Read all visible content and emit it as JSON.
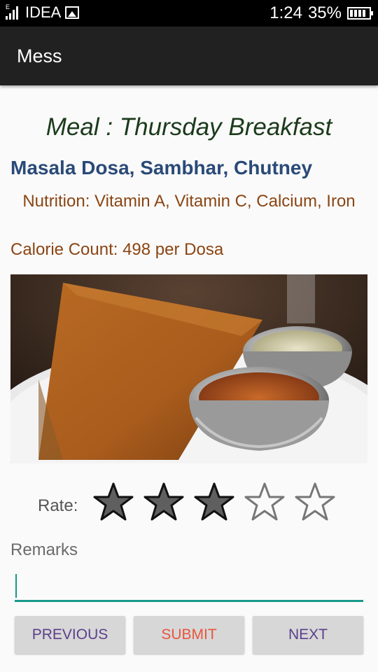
{
  "status_bar": {
    "network_type": "E",
    "carrier": "IDEA",
    "time": "1:24",
    "battery_percent": "35%",
    "icons": [
      "signal-icon",
      "gallery-icon",
      "battery-icon"
    ]
  },
  "app_bar": {
    "title": "Mess"
  },
  "meal": {
    "title": "Meal : Thursday Breakfast",
    "dishes": "Masala Dosa, Sambhar, Chutney",
    "nutrition": "Nutrition: Vitamin A, Vitamin C, Calcium, Iron",
    "calories": "Calorie Count: 498 per Dosa",
    "photo_icon": "food-photo"
  },
  "rating": {
    "label": "Rate:",
    "value": 3,
    "max": 5
  },
  "remarks": {
    "label": "Remarks",
    "value": "",
    "placeholder": ""
  },
  "buttons": {
    "previous": "PREVIOUS",
    "submit": "SUBMIT",
    "next": "NEXT"
  },
  "colors": {
    "app_bar": "#212121",
    "accent": "#16998a",
    "dishes": "#2a4a78",
    "nutrition": "#8b4513",
    "submit": "#e8553e",
    "nav_buttons": "#5b3f8c"
  }
}
